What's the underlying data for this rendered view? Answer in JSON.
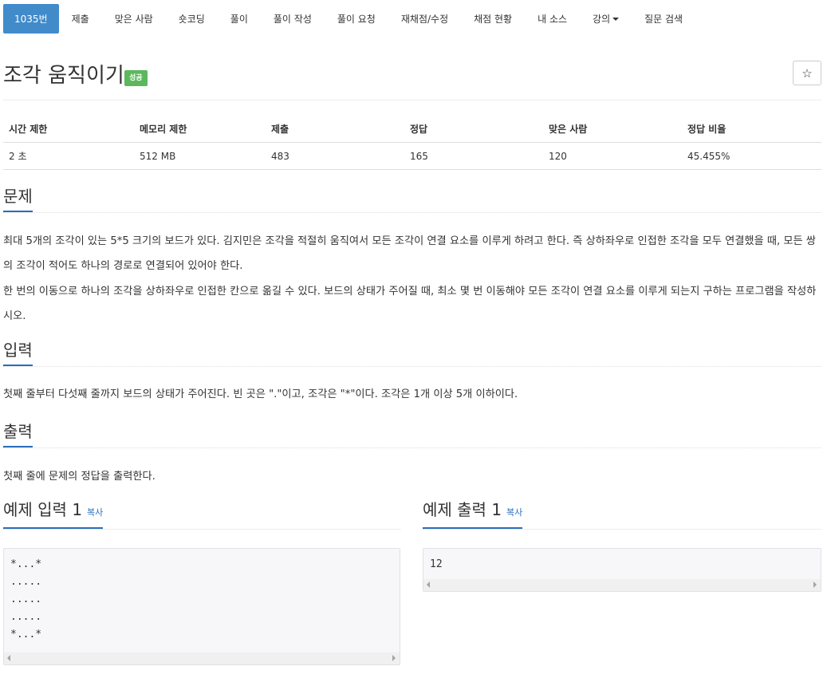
{
  "nav": {
    "problem_number": "1035번",
    "items": [
      "제출",
      "맞은 사람",
      "숏코딩",
      "풀이",
      "풀이 작성",
      "풀이 요청",
      "재채점/수정",
      "채점 현황",
      "내 소스"
    ],
    "lecture": "강의",
    "question_search": "질문 검색"
  },
  "problem": {
    "title": "조각 움직이기",
    "badge": "성공",
    "star_icon": "☆"
  },
  "info": {
    "headers": [
      "시간 제한",
      "메모리 제한",
      "제출",
      "정답",
      "맞은 사람",
      "정답 비율"
    ],
    "values": [
      "2 초",
      "512 MB",
      "483",
      "165",
      "120",
      "45.455%"
    ]
  },
  "sections": {
    "description_title": "문제",
    "description_p1": "최대 5개의 조각이 있는 5*5 크기의 보드가 있다. 김지민은 조각을 적절히 움직여서 모든 조각이 연결 요소를 이루게 하려고 한다. 즉 상하좌우로 인접한 조각을 모두 연결했을 때, 모든 쌍의 조각이 적어도 하나의 경로로 연결되어 있어야 한다.",
    "description_p2": "한 번의 이동으로 하나의 조각을 상하좌우로 인접한 칸으로 옮길 수 있다. 보드의 상태가 주어질 때, 최소 몇 번 이동해야 모든 조각이 연결 요소를 이루게 되는지 구하는 프로그램을 작성하시오.",
    "input_title": "입력",
    "input_text": "첫째 줄부터 다섯째 줄까지 보드의 상태가 주어진다. 빈 곳은 \".\"이고, 조각은 \"*\"이다. 조각은 1개 이상 5개 이하이다.",
    "output_title": "출력",
    "output_text": "첫째 줄에 문제의 정답을 출력한다."
  },
  "samples": {
    "input_title": "예제 입력 1",
    "output_title": "예제 출력 1",
    "copy_label": "복사",
    "input_text": "*...*\n.....\n.....\n.....\n*...*",
    "output_text": "12"
  }
}
